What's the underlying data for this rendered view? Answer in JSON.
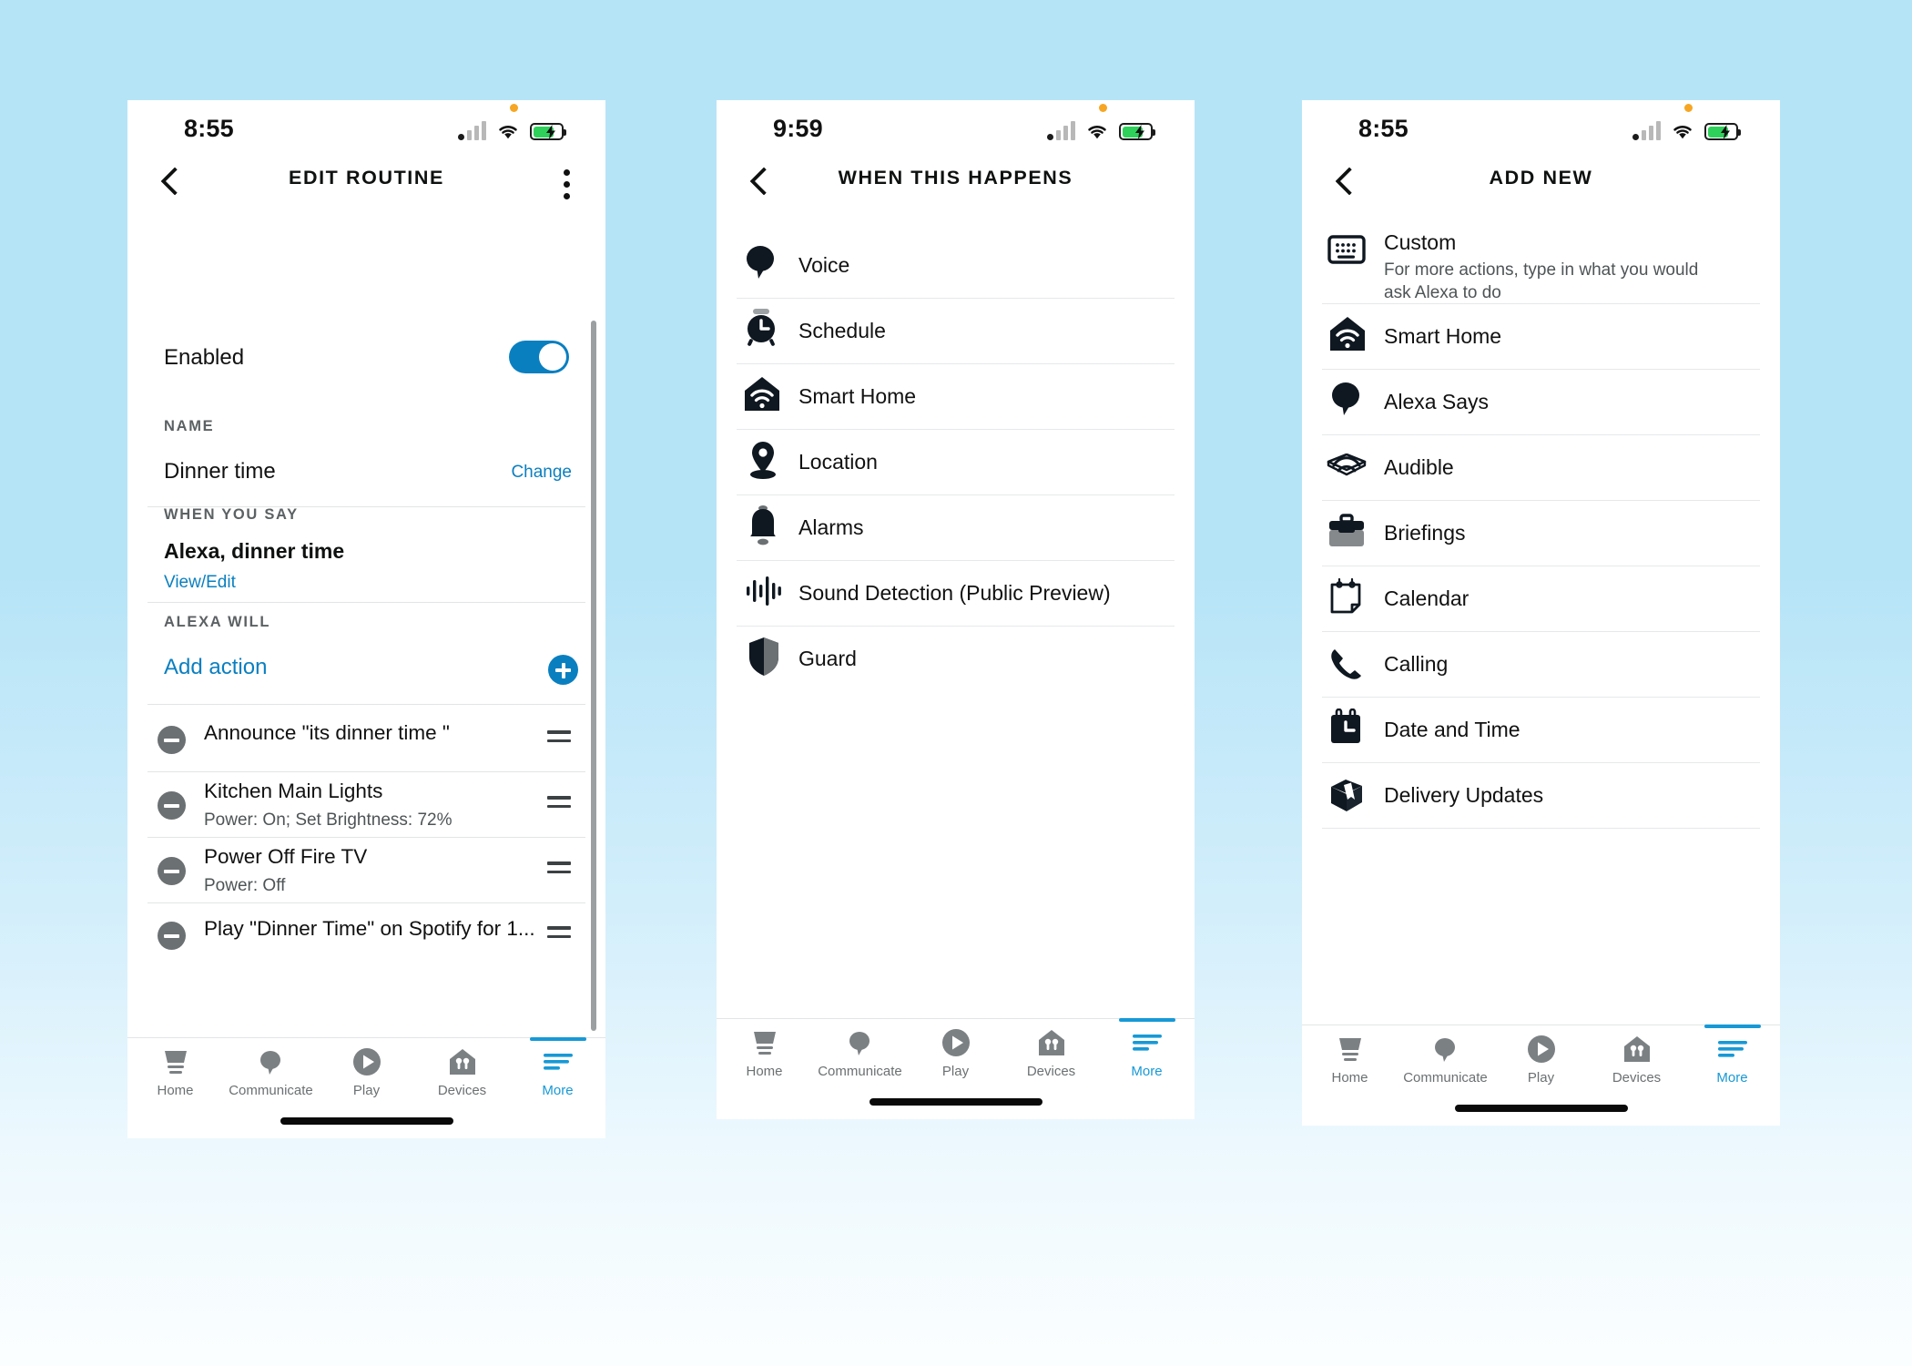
{
  "theme": {
    "accent": "#0a7fc0",
    "tab_active": "#1799d6",
    "text": "#111111",
    "muted": "#4e5456",
    "background_top": "#b6e4f7",
    "background_bottom": "#fbfeff",
    "battery_green": "#2fd15b",
    "status_dot_orange": "#f6a623"
  },
  "tabbar": {
    "items": [
      {
        "label": "Home",
        "icon": "home-icon",
        "active": false
      },
      {
        "label": "Communicate",
        "icon": "speech-bubble-icon",
        "active": false
      },
      {
        "label": "Play",
        "icon": "play-circle-icon",
        "active": false
      },
      {
        "label": "Devices",
        "icon": "devices-house-icon",
        "active": false
      },
      {
        "label": "More",
        "icon": "hamburger-lines-icon",
        "active": true
      }
    ]
  },
  "phone1": {
    "status": {
      "time": "8:55",
      "signal_icon": "cellular-bars-icon",
      "wifi_icon": "wifi-icon",
      "battery_icon": "battery-charging-icon"
    },
    "header": {
      "title": "EDIT ROUTINE",
      "back_icon": "chevron-left-icon",
      "overflow_icon": "kebab-menu-icon"
    },
    "enabled": {
      "label": "Enabled",
      "toggle_on": true
    },
    "name_section": {
      "heading": "NAME",
      "value": "Dinner time",
      "change_label": "Change"
    },
    "trigger_section": {
      "heading": "WHEN YOU SAY",
      "phrase": "Alexa, dinner time",
      "view_edit_label": "View/Edit"
    },
    "actions_section": {
      "heading": "ALEXA WILL",
      "add_action_label": "Add action",
      "add_icon": "plus-circle-icon",
      "items": [
        {
          "title": "Announce \"its dinner time \"",
          "subtitle": ""
        },
        {
          "title": "Kitchen Main Lights",
          "subtitle": "Power: On; Set Brightness: 72%"
        },
        {
          "title": "Power Off Fire TV",
          "subtitle": "Power: Off"
        },
        {
          "title": "Play \"Dinner Time\" on Spotify for  1...",
          "subtitle": ""
        }
      ]
    }
  },
  "phone2": {
    "status": {
      "time": "9:59",
      "signal_icon": "cellular-bars-icon",
      "wifi_icon": "wifi-icon",
      "battery_icon": "battery-charging-icon"
    },
    "header": {
      "title": "WHEN THIS HAPPENS",
      "back_icon": "chevron-left-icon"
    },
    "items": [
      {
        "label": "Voice",
        "icon": "speech-bubble-icon"
      },
      {
        "label": "Schedule",
        "icon": "alarm-clock-icon"
      },
      {
        "label": "Smart Home",
        "icon": "smart-home-icon"
      },
      {
        "label": "Location",
        "icon": "map-pin-icon"
      },
      {
        "label": "Alarms",
        "icon": "bell-icon"
      },
      {
        "label": "Sound Detection (Public Preview)",
        "icon": "waveform-icon"
      },
      {
        "label": "Guard",
        "icon": "shield-icon"
      }
    ]
  },
  "phone3": {
    "status": {
      "time": "8:55",
      "signal_icon": "cellular-bars-icon",
      "wifi_icon": "wifi-icon",
      "battery_icon": "battery-charging-icon"
    },
    "header": {
      "title": "ADD NEW",
      "back_icon": "chevron-left-icon"
    },
    "items": [
      {
        "label": "Custom",
        "sublabel": "For more actions, type in what you would ask Alexa to do",
        "icon": "keyboard-icon"
      },
      {
        "label": "Smart Home",
        "sublabel": "",
        "icon": "smart-home-icon"
      },
      {
        "label": "Alexa Says",
        "sublabel": "",
        "icon": "speech-bubble-icon"
      },
      {
        "label": "Audible",
        "sublabel": "",
        "icon": "audible-icon"
      },
      {
        "label": "Briefings",
        "sublabel": "",
        "icon": "briefcase-icon"
      },
      {
        "label": "Calendar",
        "sublabel": "",
        "icon": "calendar-page-icon"
      },
      {
        "label": "Calling",
        "sublabel": "",
        "icon": "phone-handset-icon"
      },
      {
        "label": "Date and Time",
        "sublabel": "",
        "icon": "calendar-clock-icon"
      },
      {
        "label": "Delivery Updates",
        "sublabel": "",
        "icon": "package-box-icon"
      }
    ]
  }
}
